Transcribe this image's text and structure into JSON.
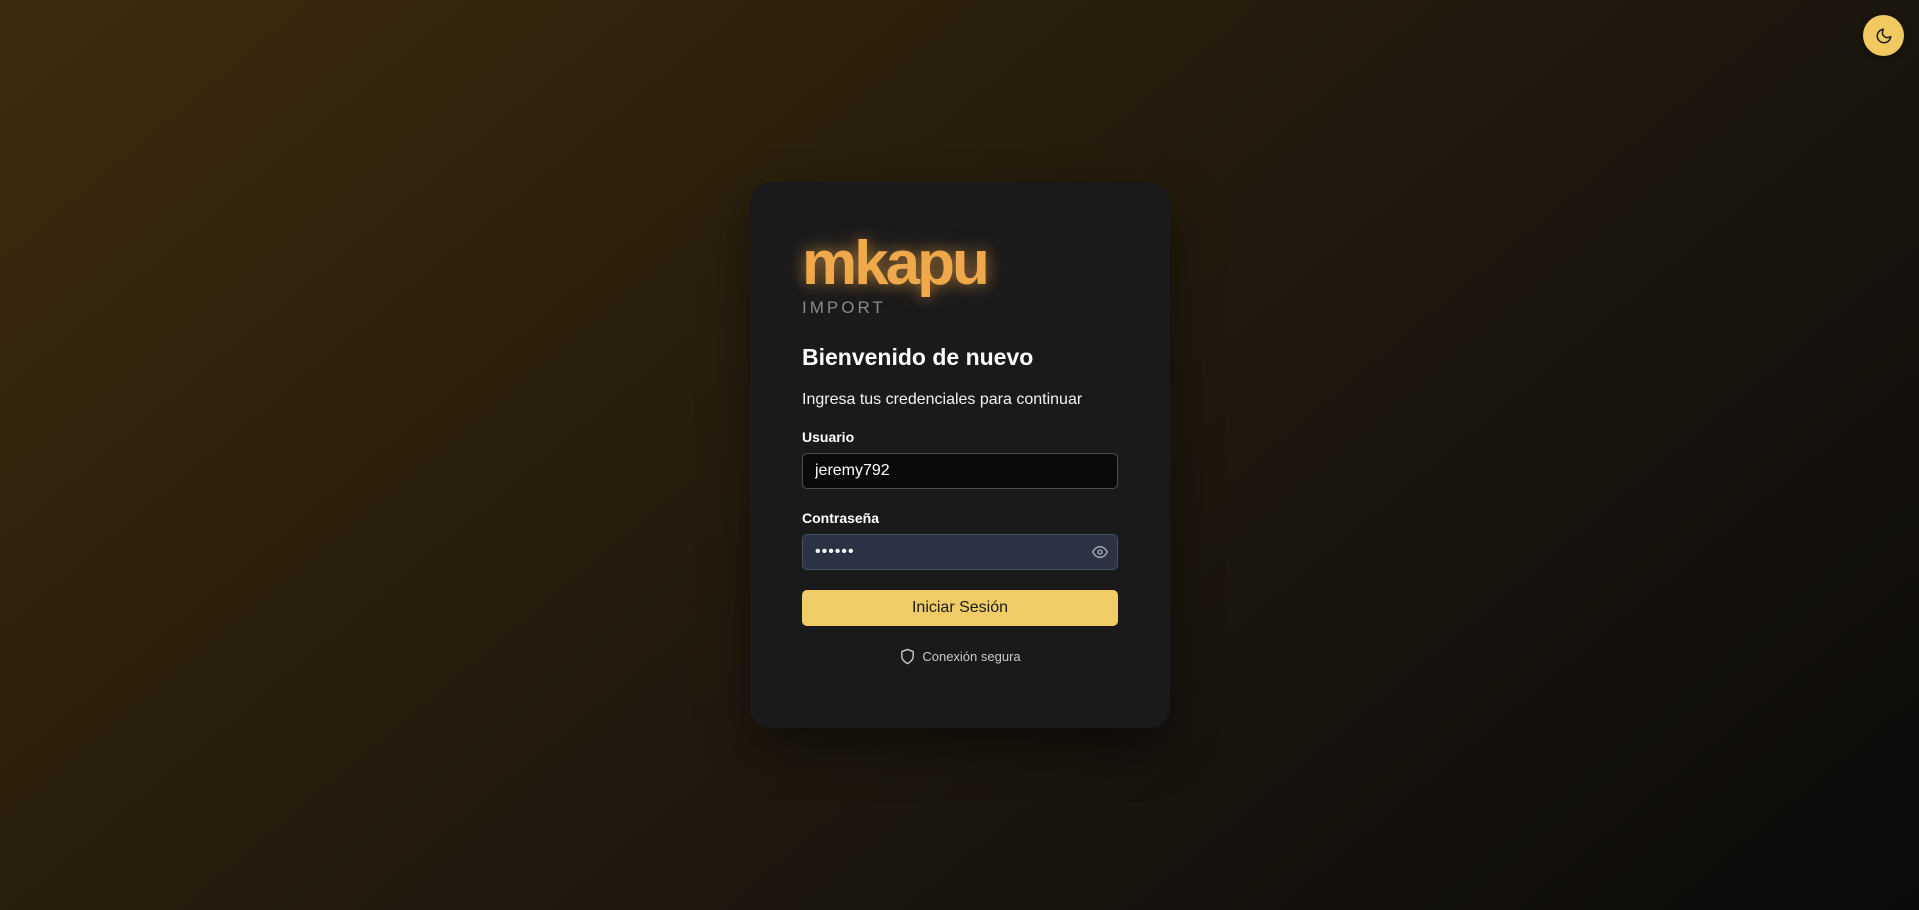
{
  "theme_toggle": {
    "icon": "moon-icon"
  },
  "brand": {
    "name": "mkapu",
    "tagline": "IMPORT",
    "color": "#efa84a"
  },
  "login": {
    "title": "Bienvenido de nuevo",
    "subtitle": "Ingresa tus credenciales para continuar",
    "username": {
      "label": "Usuario",
      "value": "jeremy792"
    },
    "password": {
      "label": "Contraseña",
      "value": "••••••",
      "toggle_icon": "eye-icon"
    },
    "submit_label": "Iniciar Sesión",
    "secure_note": {
      "icon": "shield-icon",
      "text": "Conexión segura"
    }
  },
  "colors": {
    "accent": "#efcc66",
    "card_background": "#1a1a1c",
    "password_field_background": "#2b3243"
  }
}
